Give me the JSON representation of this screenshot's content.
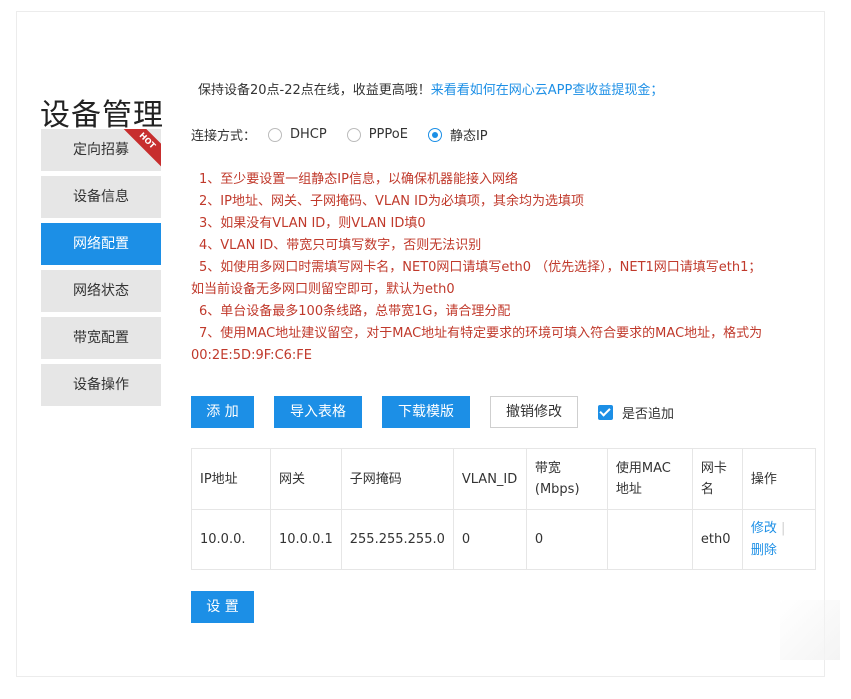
{
  "page": {
    "title": "设备管理"
  },
  "sidebar": {
    "items": [
      {
        "label": "定向招募",
        "badge": "HOT",
        "active": false
      },
      {
        "label": "设备信息",
        "active": false
      },
      {
        "label": "网络配置",
        "active": true
      },
      {
        "label": "网络状态",
        "active": false
      },
      {
        "label": "带宽配置",
        "active": false
      },
      {
        "label": "设备操作",
        "active": false
      }
    ]
  },
  "notice": {
    "text": "保持设备20点-22点在线，收益更高哦！",
    "link": "来看看如何在网心云APP查收益提现金；"
  },
  "connection": {
    "label": "连接方式：",
    "options": [
      {
        "label": "DHCP",
        "checked": false
      },
      {
        "label": "PPPoE",
        "checked": false
      },
      {
        "label": "静态IP",
        "checked": true
      }
    ]
  },
  "rules": [
    "1、至少要设置一组静态IP信息，以确保机器能接入网络",
    "2、IP地址、网关、子网掩码、VLAN ID为必填项，其余均为选填项",
    "3、如果没有VLAN ID，则VLAN ID填0",
    "4、VLAN ID、带宽只可填写数字，否则无法识别",
    "5、如使用多网口时需填写网卡名，NET0网口请填写eth0 （优先选择），NET1网口请填写eth1；",
    "如当前设备无多网口则留空即可，默认为eth0",
    "6、单台设备最多100条线路，总带宽1G，请合理分配",
    "7、使用MAC地址建议留空，对于MAC地址有特定要求的环境可填入符合要求的MAC地址，格式为",
    "00:2E:5D:9F:C6:FE"
  ],
  "toolbar": {
    "add": "添 加",
    "import": "导入表格",
    "download": "下载模版",
    "undo": "撤销修改",
    "append_label": "是否追加",
    "append_checked": true
  },
  "table": {
    "headers": {
      "ip": "IP地址",
      "gateway": "网关",
      "mask": "子网掩码",
      "vlan": "VLAN_ID",
      "bw1": "带宽",
      "bw2": "(Mbps)",
      "mac1": "使用MAC",
      "mac2": "地址",
      "nic1": "网卡",
      "nic2": "名",
      "op": "操作"
    },
    "row": {
      "ip": "10.0.0.",
      "gateway": "10.0.0.1",
      "mask": "255.255.255.0",
      "vlan": "0",
      "bandwidth": "0",
      "mac": "",
      "nic": "eth0",
      "edit": "修改",
      "sep": "|",
      "delete": "删除"
    }
  },
  "submit": {
    "label": "设 置"
  },
  "colors": {
    "accent": "#1c8fe6",
    "warning_text": "#c0392b",
    "hot_badge": "#c72e2e"
  }
}
